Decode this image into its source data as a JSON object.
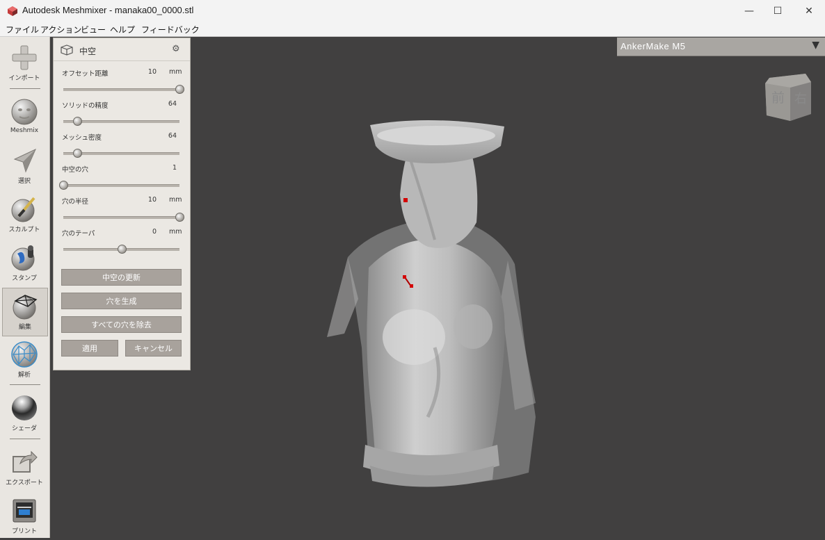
{
  "window": {
    "title": "Autodesk Meshmixer - manaka00_0000.stl",
    "minimize_glyph": "—",
    "maximize_glyph": "☐",
    "close_glyph": "✕"
  },
  "menu": [
    "ファイル",
    "アクション",
    "ビュー",
    "ヘルプ",
    "フィードバック"
  ],
  "toolbar": [
    {
      "label": "インポート",
      "icon": "plus-icon"
    },
    {
      "label": "Meshmix",
      "icon": "meshmix-face-icon"
    },
    {
      "label": "選択",
      "icon": "select-arrow-icon"
    },
    {
      "label": "スカルプト",
      "icon": "sculpt-brush-icon"
    },
    {
      "label": "スタンプ",
      "icon": "stamp-icon"
    },
    {
      "label": "編集",
      "icon": "edit-mesh-icon",
      "active": true
    },
    {
      "label": "解析",
      "icon": "analysis-mesh-icon"
    },
    {
      "label": "シェーダ",
      "icon": "shader-sphere-icon"
    },
    {
      "label": "エクスポート",
      "icon": "export-icon"
    },
    {
      "label": "プリント",
      "icon": "print-icon"
    }
  ],
  "panel": {
    "title": "中空",
    "params": [
      {
        "label": "オフセット距離",
        "value": "10",
        "unit": "mm",
        "level": 1.0
      },
      {
        "label": "ソリッドの精度",
        "value": "64",
        "unit": "",
        "level": 0.12
      },
      {
        "label": "メッシュ密度",
        "value": "64",
        "unit": "",
        "level": 0.12
      },
      {
        "label": "中空の穴",
        "value": "1",
        "unit": "",
        "level": 0.0
      },
      {
        "label": "穴の半径",
        "value": "10",
        "unit": "mm",
        "level": 1.0
      },
      {
        "label": "穴のテーパ",
        "value": "0",
        "unit": "mm",
        "level": 0.5
      }
    ],
    "buttons": {
      "update": "中空の更新",
      "generate_holes": "穴を生成",
      "remove_all_holes": "すべての穴を除去",
      "apply": "適用",
      "cancel": "キャンセル"
    }
  },
  "printer": {
    "name": "AnkerMake M5",
    "arrow": "▼"
  },
  "viewcube": {
    "front": "前",
    "right": "右"
  },
  "colors": {
    "background": "#414040",
    "panel": "#ebe8e3",
    "button": "#a8a29c",
    "marker": "#d40000"
  }
}
